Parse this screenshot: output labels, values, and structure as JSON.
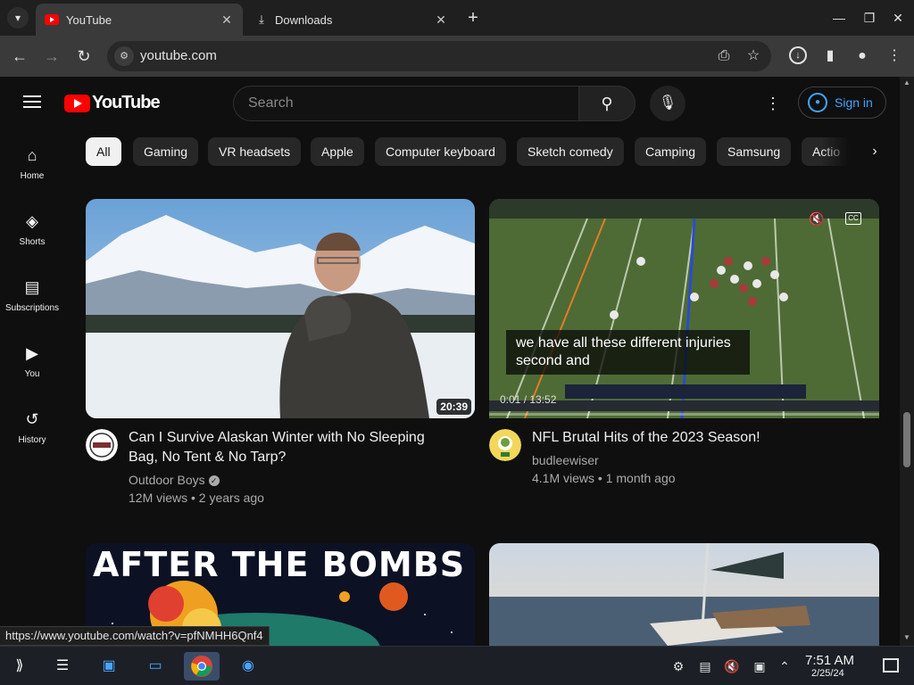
{
  "browser": {
    "tabs": [
      {
        "title": "YouTube",
        "active": true
      },
      {
        "title": "Downloads",
        "active": false
      }
    ],
    "new_tab_symbol": "+",
    "url": "youtube.com"
  },
  "youtube": {
    "logo_text": "YouTube",
    "search_placeholder": "Search",
    "sign_in_label": "Sign in",
    "sidebar": [
      {
        "label": "Home",
        "icon": "home-icon"
      },
      {
        "label": "Shorts",
        "icon": "shorts-icon"
      },
      {
        "label": "Subscriptions",
        "icon": "subscriptions-icon"
      },
      {
        "label": "You",
        "icon": "you-icon"
      },
      {
        "label": "History",
        "icon": "history-icon"
      }
    ],
    "chips": [
      "All",
      "Gaming",
      "VR headsets",
      "Apple",
      "Computer keyboard",
      "Sketch comedy",
      "Camping",
      "Samsung",
      "Actio"
    ],
    "videos": [
      {
        "title": "Can I Survive Alaskan Winter with No Sleeping Bag, No Tent & No Tarp?",
        "channel": "Outdoor Boys",
        "verified": true,
        "meta": "12M views • 2 years ago",
        "duration": "20:39"
      },
      {
        "title": "NFL Brutal Hits of the 2023 Season!",
        "channel": "budleewiser",
        "verified": false,
        "meta": "4.1M views • 1 month ago",
        "preview_caption": "we have all these different injuries second and",
        "preview_time": "0:01 / 13:52"
      },
      {
        "title_overlay": "AFTER THE BOMBS"
      },
      {}
    ]
  },
  "status_url": "https://www.youtube.com/watch?v=pfNMHH6Qnf4",
  "taskbar": {
    "time": "7:51 AM",
    "date": "2/25/24"
  },
  "colors": {
    "youtube_red": "#ff0000",
    "link_blue": "#3ea6ff",
    "background": "#0f0f0f"
  }
}
